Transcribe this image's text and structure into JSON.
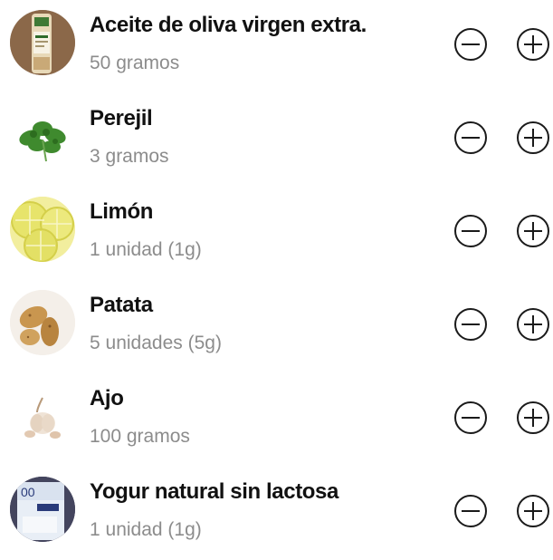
{
  "ingredients": [
    {
      "name": "Aceite de oliva virgen extra.",
      "quantity": "50 gramos",
      "image": "olive-oil-bottle-image"
    },
    {
      "name": "Perejil",
      "quantity": "3 gramos",
      "image": "parsley-image"
    },
    {
      "name": "Limón",
      "quantity": "1 unidad (1g)",
      "image": "lemon-slices-image"
    },
    {
      "name": "Patata",
      "quantity": "5 unidades (5g)",
      "image": "potatoes-image"
    },
    {
      "name": "Ajo",
      "quantity": "100 gramos",
      "image": "garlic-image"
    },
    {
      "name": "Yogur natural sin lactosa",
      "quantity": "1 unidad (1g)",
      "image": "lactose-free-yogurt-image"
    }
  ],
  "icons": {
    "decrease": "minus-circle-icon",
    "increase": "plus-circle-icon"
  },
  "colors": {
    "name_text": "#111111",
    "quantity_text": "#8c8c8c",
    "icon_stroke": "#1a1a1a"
  }
}
